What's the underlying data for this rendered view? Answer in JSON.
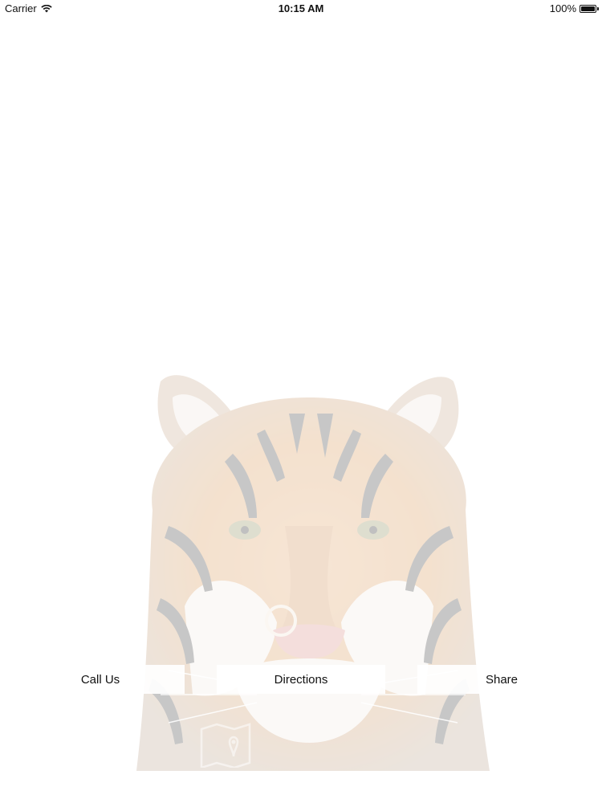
{
  "status_bar": {
    "carrier": "Carrier",
    "time": "10:15 AM",
    "battery_percent": "100%",
    "battery_level": 1.0,
    "wifi_icon": "wifi-icon",
    "battery_icon": "battery-icon"
  },
  "actions": {
    "call_label": "Call Us",
    "directions_label": "Directions",
    "share_label": "Share"
  },
  "background": {
    "subject_icon": "tiger-image"
  },
  "colors": {
    "background": "#ffffff",
    "text": "#111111",
    "button_bg": "#ffffff"
  }
}
